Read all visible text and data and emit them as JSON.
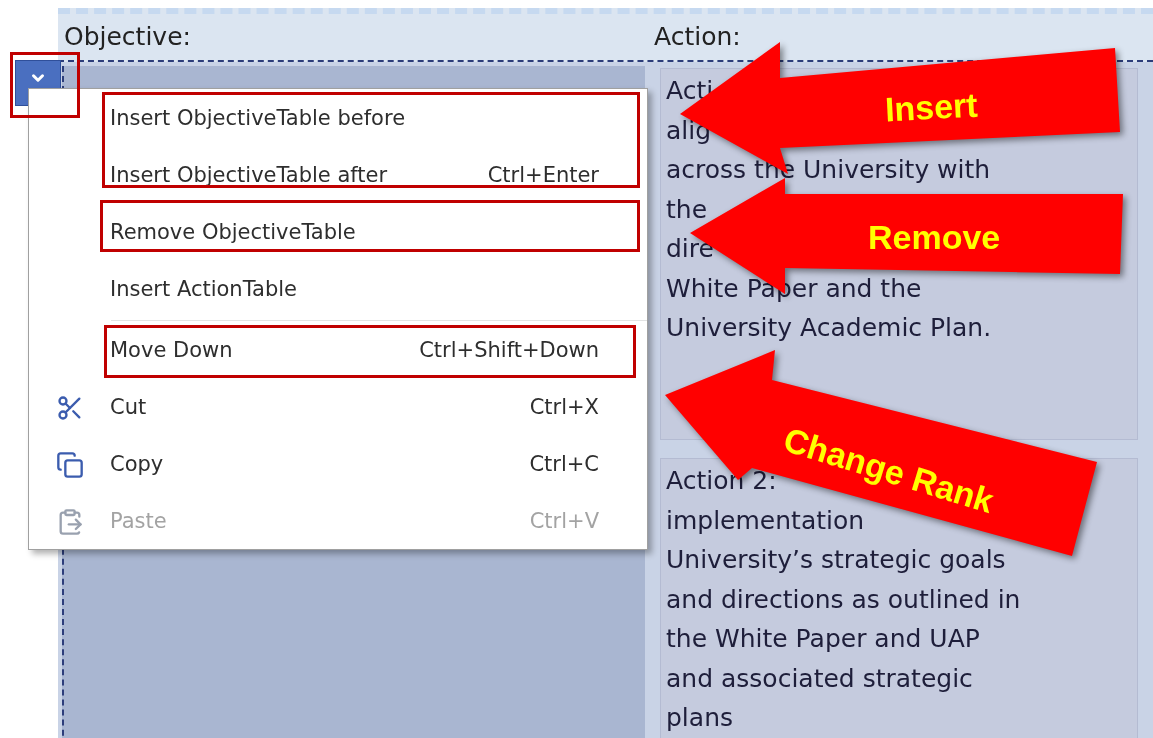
{
  "header": {
    "columns": [
      "Objective:",
      "Action:"
    ]
  },
  "actions": [
    {
      "lines": [
        "Acti",
        "alig",
        "across the University with",
        "the",
        "dire",
        "White Paper and the",
        "University Academic Plan."
      ]
    },
    {
      "lines": [
        "Action 2:",
        "implementation",
        "University’s strategic goals",
        "and directions as outlined in",
        "the White Paper and UAP",
        "and associated strategic",
        "plans"
      ]
    }
  ],
  "context_menu": {
    "items": [
      {
        "kind": "item",
        "label": "Insert ObjectiveTable before",
        "disabled": false
      },
      {
        "kind": "item",
        "label": "Insert ObjectiveTable after",
        "shortcut": "Ctrl+Enter",
        "disabled": false
      },
      {
        "kind": "item",
        "label": "Remove ObjectiveTable",
        "disabled": false
      },
      {
        "kind": "item",
        "label": "Insert ActionTable",
        "disabled": false
      },
      {
        "kind": "separator"
      },
      {
        "kind": "item",
        "label": "Move Down",
        "shortcut": "Ctrl+Shift+Down",
        "disabled": false
      },
      {
        "kind": "cut",
        "label": "Cut",
        "shortcut": "Ctrl+X",
        "disabled": false
      },
      {
        "kind": "copy",
        "label": "Copy",
        "shortcut": "Ctrl+C",
        "disabled": false
      },
      {
        "kind": "paste",
        "label": "Paste",
        "shortcut": "Ctrl+V",
        "disabled": true
      }
    ]
  },
  "callouts": [
    {
      "label": "Insert"
    },
    {
      "label": "Remove"
    },
    {
      "label": "Change Rank"
    }
  ]
}
